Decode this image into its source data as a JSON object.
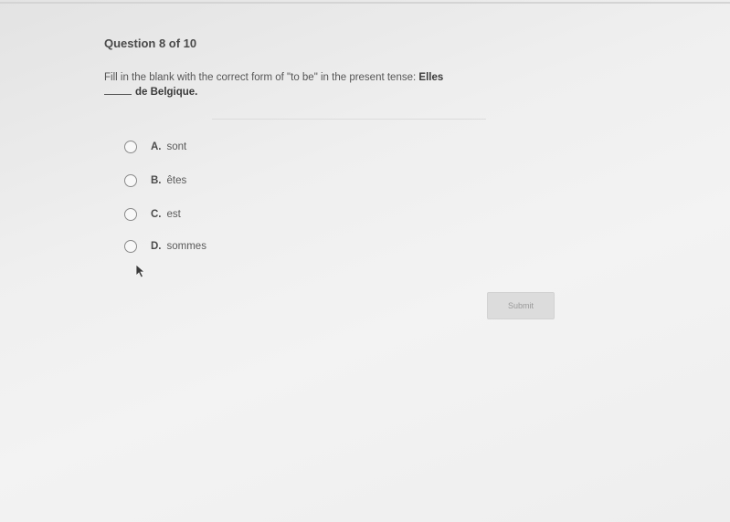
{
  "question": {
    "header": "Question 8 of 10",
    "prompt_text": "Fill in the blank with the correct form of \"to be\" in the present tense:",
    "prompt_subject": "Elles",
    "prompt_rest": "de Belgique."
  },
  "options": [
    {
      "letter": "A.",
      "text": "sont"
    },
    {
      "letter": "B.",
      "text": "êtes"
    },
    {
      "letter": "C.",
      "text": "est"
    },
    {
      "letter": "D.",
      "text": "sommes"
    }
  ],
  "submit_label": "Submit",
  "colors": {
    "background": "#efefef",
    "text": "#4a4a4a",
    "submit_bg": "#dcdcdc",
    "submit_text": "#9a9a9a"
  }
}
